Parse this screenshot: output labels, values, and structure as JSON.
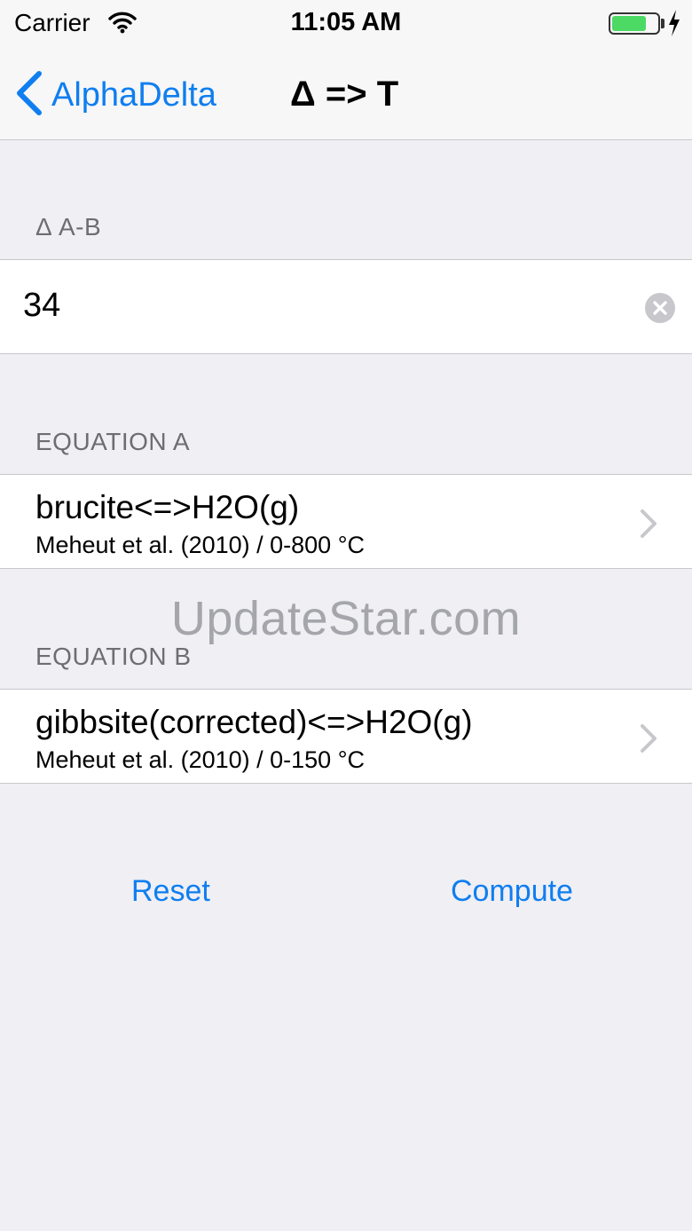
{
  "status_bar": {
    "carrier": "Carrier",
    "time": "11:05 AM",
    "battery_level": 0.75,
    "signal_icon": "wifi-icon",
    "charging_icon": "bolt-icon"
  },
  "nav": {
    "back_label": "AlphaDelta",
    "title": "Δ => T"
  },
  "delta_section": {
    "header": "Δ A-B",
    "value": "34"
  },
  "equation_a": {
    "header": "EQUATION A",
    "title": "brucite<=>H2O(g)",
    "subtitle": "Meheut et al. (2010) / 0-800 °C"
  },
  "equation_b": {
    "header": "EQUATION B",
    "title": "gibbsite(corrected)<=>H2O(g)",
    "subtitle": "Meheut et al. (2010) / 0-150 °C"
  },
  "watermark": "UpdateStar.com",
  "actions": {
    "reset_label": "Reset",
    "compute_label": "Compute"
  },
  "colors": {
    "accent": "#0f7ef0",
    "background": "#efeff4",
    "battery": "#4cd964"
  }
}
